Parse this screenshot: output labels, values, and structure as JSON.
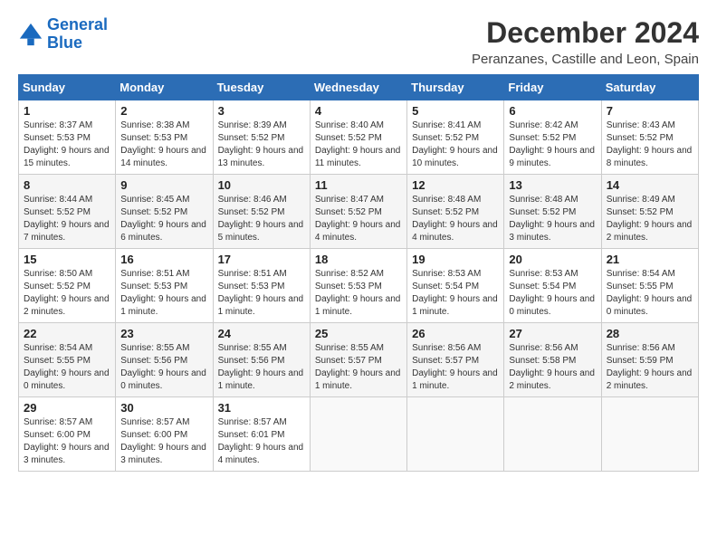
{
  "logo": {
    "line1": "General",
    "line2": "Blue"
  },
  "title": "December 2024",
  "subtitle": "Peranzanes, Castille and Leon, Spain",
  "headers": [
    "Sunday",
    "Monday",
    "Tuesday",
    "Wednesday",
    "Thursday",
    "Friday",
    "Saturday"
  ],
  "weeks": [
    [
      {
        "day": "1",
        "info": "Sunrise: 8:37 AM\nSunset: 5:53 PM\nDaylight: 9 hours and 15 minutes."
      },
      {
        "day": "2",
        "info": "Sunrise: 8:38 AM\nSunset: 5:53 PM\nDaylight: 9 hours and 14 minutes."
      },
      {
        "day": "3",
        "info": "Sunrise: 8:39 AM\nSunset: 5:52 PM\nDaylight: 9 hours and 13 minutes."
      },
      {
        "day": "4",
        "info": "Sunrise: 8:40 AM\nSunset: 5:52 PM\nDaylight: 9 hours and 11 minutes."
      },
      {
        "day": "5",
        "info": "Sunrise: 8:41 AM\nSunset: 5:52 PM\nDaylight: 9 hours and 10 minutes."
      },
      {
        "day": "6",
        "info": "Sunrise: 8:42 AM\nSunset: 5:52 PM\nDaylight: 9 hours and 9 minutes."
      },
      {
        "day": "7",
        "info": "Sunrise: 8:43 AM\nSunset: 5:52 PM\nDaylight: 9 hours and 8 minutes."
      }
    ],
    [
      {
        "day": "8",
        "info": "Sunrise: 8:44 AM\nSunset: 5:52 PM\nDaylight: 9 hours and 7 minutes."
      },
      {
        "day": "9",
        "info": "Sunrise: 8:45 AM\nSunset: 5:52 PM\nDaylight: 9 hours and 6 minutes."
      },
      {
        "day": "10",
        "info": "Sunrise: 8:46 AM\nSunset: 5:52 PM\nDaylight: 9 hours and 5 minutes."
      },
      {
        "day": "11",
        "info": "Sunrise: 8:47 AM\nSunset: 5:52 PM\nDaylight: 9 hours and 4 minutes."
      },
      {
        "day": "12",
        "info": "Sunrise: 8:48 AM\nSunset: 5:52 PM\nDaylight: 9 hours and 4 minutes."
      },
      {
        "day": "13",
        "info": "Sunrise: 8:48 AM\nSunset: 5:52 PM\nDaylight: 9 hours and 3 minutes."
      },
      {
        "day": "14",
        "info": "Sunrise: 8:49 AM\nSunset: 5:52 PM\nDaylight: 9 hours and 2 minutes."
      }
    ],
    [
      {
        "day": "15",
        "info": "Sunrise: 8:50 AM\nSunset: 5:52 PM\nDaylight: 9 hours and 2 minutes."
      },
      {
        "day": "16",
        "info": "Sunrise: 8:51 AM\nSunset: 5:53 PM\nDaylight: 9 hours and 1 minute."
      },
      {
        "day": "17",
        "info": "Sunrise: 8:51 AM\nSunset: 5:53 PM\nDaylight: 9 hours and 1 minute."
      },
      {
        "day": "18",
        "info": "Sunrise: 8:52 AM\nSunset: 5:53 PM\nDaylight: 9 hours and 1 minute."
      },
      {
        "day": "19",
        "info": "Sunrise: 8:53 AM\nSunset: 5:54 PM\nDaylight: 9 hours and 1 minute."
      },
      {
        "day": "20",
        "info": "Sunrise: 8:53 AM\nSunset: 5:54 PM\nDaylight: 9 hours and 0 minutes."
      },
      {
        "day": "21",
        "info": "Sunrise: 8:54 AM\nSunset: 5:55 PM\nDaylight: 9 hours and 0 minutes."
      }
    ],
    [
      {
        "day": "22",
        "info": "Sunrise: 8:54 AM\nSunset: 5:55 PM\nDaylight: 9 hours and 0 minutes."
      },
      {
        "day": "23",
        "info": "Sunrise: 8:55 AM\nSunset: 5:56 PM\nDaylight: 9 hours and 0 minutes."
      },
      {
        "day": "24",
        "info": "Sunrise: 8:55 AM\nSunset: 5:56 PM\nDaylight: 9 hours and 1 minute."
      },
      {
        "day": "25",
        "info": "Sunrise: 8:55 AM\nSunset: 5:57 PM\nDaylight: 9 hours and 1 minute."
      },
      {
        "day": "26",
        "info": "Sunrise: 8:56 AM\nSunset: 5:57 PM\nDaylight: 9 hours and 1 minute."
      },
      {
        "day": "27",
        "info": "Sunrise: 8:56 AM\nSunset: 5:58 PM\nDaylight: 9 hours and 2 minutes."
      },
      {
        "day": "28",
        "info": "Sunrise: 8:56 AM\nSunset: 5:59 PM\nDaylight: 9 hours and 2 minutes."
      }
    ],
    [
      {
        "day": "29",
        "info": "Sunrise: 8:57 AM\nSunset: 6:00 PM\nDaylight: 9 hours and 3 minutes."
      },
      {
        "day": "30",
        "info": "Sunrise: 8:57 AM\nSunset: 6:00 PM\nDaylight: 9 hours and 3 minutes."
      },
      {
        "day": "31",
        "info": "Sunrise: 8:57 AM\nSunset: 6:01 PM\nDaylight: 9 hours and 4 minutes."
      },
      {
        "day": "",
        "info": ""
      },
      {
        "day": "",
        "info": ""
      },
      {
        "day": "",
        "info": ""
      },
      {
        "day": "",
        "info": ""
      }
    ]
  ]
}
